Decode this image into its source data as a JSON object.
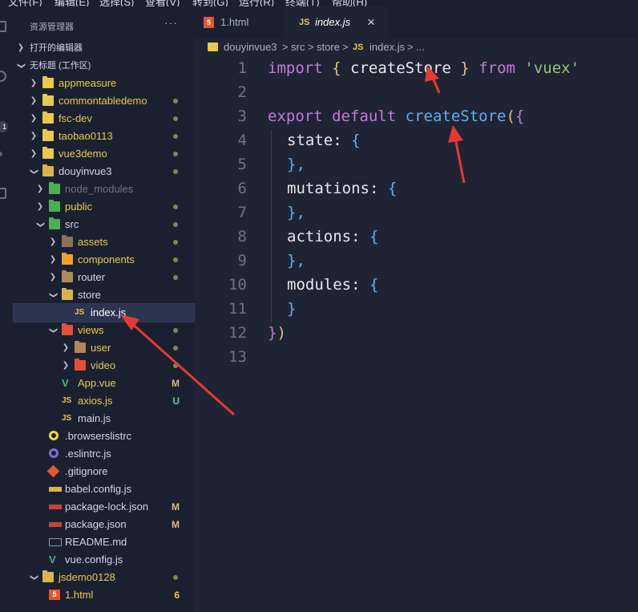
{
  "menubar": [
    "文件(F)",
    "编辑(E)",
    "选择(S)",
    "查看(V)",
    "转到(G)",
    "运行(R)",
    "终端(T)",
    "帮助(H)"
  ],
  "sidebar": {
    "title": "资源管理器",
    "more": "···",
    "open_editors": "打开的编辑器",
    "workspace": "无标题 (工作区)"
  },
  "tree": [
    {
      "label": "appmeasure",
      "color": "#e8c94d"
    },
    {
      "label": "commontabledemo",
      "color": "#e8c94d"
    },
    {
      "label": "fsc-dev",
      "color": "#e8c94d"
    },
    {
      "label": "taobao0113",
      "color": "#e8c94d"
    },
    {
      "label": "vue3demo",
      "color": "#e8c94d"
    },
    {
      "label": "douyinvue3",
      "color": "#cfd6e4"
    },
    {
      "label": "node_modules",
      "color": "#6c7487"
    },
    {
      "label": "public",
      "color": "#e8c94d"
    },
    {
      "label": "src",
      "color": "#cfd6e4"
    },
    {
      "label": "assets",
      "color": "#e8c94d"
    },
    {
      "label": "components",
      "color": "#e8c94d"
    },
    {
      "label": "router",
      "color": "#cfd6e4"
    },
    {
      "label": "store",
      "color": "#cfd6e4"
    },
    {
      "label": "index.js",
      "color": "#ffffff"
    },
    {
      "label": "views",
      "color": "#e8c94d"
    },
    {
      "label": "user",
      "color": "#e8c94d"
    },
    {
      "label": "video",
      "color": "#e8c94d"
    },
    {
      "label": "App.vue",
      "color": "#e8c94d",
      "badge": "M"
    },
    {
      "label": "axios.js",
      "color": "#e8c94d",
      "badge": "U"
    },
    {
      "label": "main.js",
      "color": "#cfd6e4"
    },
    {
      "label": ".browserslistrc",
      "color": "#cfd6e4"
    },
    {
      "label": ".eslintrc.js",
      "color": "#cfd6e4"
    },
    {
      "label": ".gitignore",
      "color": "#cfd6e4"
    },
    {
      "label": "babel.config.js",
      "color": "#cfd6e4"
    },
    {
      "label": "package-lock.json",
      "color": "#cfd6e4",
      "badge": "M"
    },
    {
      "label": "package.json",
      "color": "#cfd6e4",
      "badge": "M"
    },
    {
      "label": "README.md",
      "color": "#cfd6e4"
    },
    {
      "label": "vue.config.js",
      "color": "#cfd6e4"
    },
    {
      "label": "jsdemo0128",
      "color": "#e8c94d"
    },
    {
      "label": "1.html",
      "color": "#e8c94d",
      "badge": "6"
    }
  ],
  "icons": {
    "folder": "folder-icon",
    "js": "JS",
    "html": "5",
    "vue": "V"
  },
  "tabs": [
    {
      "label": "1.html",
      "active": false
    },
    {
      "label": "index.js",
      "active": true,
      "close": "×"
    }
  ],
  "breadcrumb": [
    "douyinvue3",
    "src",
    "store",
    "index.js",
    "..."
  ],
  "breadcrumb_sep": ">",
  "code": {
    "line_numbers": [
      "1",
      "2",
      "3",
      "4",
      "5",
      "6",
      "7",
      "8",
      "9",
      "10",
      "11",
      "12",
      "13"
    ],
    "l1": {
      "import": "import",
      "ob": "{",
      "name": "createStore",
      "cb": "}",
      "from": "from",
      "str": "'vuex'"
    },
    "l3": {
      "export": "export",
      "default": "default",
      "fn": "createStore",
      "paren": "(",
      "brace": "{"
    },
    "l4": {
      "key": "state:",
      "brace": "{"
    },
    "l5": "},",
    "l6": {
      "key": "mutations:",
      "brace": "{"
    },
    "l7": "},",
    "l8": {
      "key": "actions:",
      "brace": "{"
    },
    "l9": "},",
    "l10": {
      "key": "modules:",
      "brace": "{"
    },
    "l11": "}",
    "l12": {
      "brace": "}",
      "paren": ")"
    }
  },
  "colors": {
    "accent_arrow": "#e53a32",
    "modified_dot": "#7b8a5a",
    "badge_M": "#d7ba7d",
    "badge_U": "#73c991",
    "badge_6": "#e8c94d"
  }
}
